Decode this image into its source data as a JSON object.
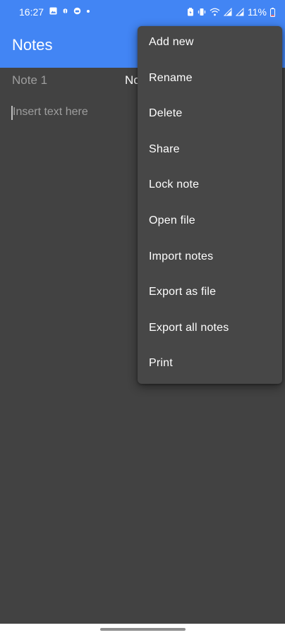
{
  "status_bar": {
    "time": "16:27",
    "battery": "11%",
    "left_icons": [
      "image-icon",
      "bug-icon",
      "robot-icon",
      "dot-icon"
    ],
    "right_icons": [
      "battery-saver-icon",
      "vibrate-icon",
      "wifi-icon",
      "signal-icon",
      "signal-icon",
      "battery-icon"
    ]
  },
  "app_bar": {
    "title": "Notes"
  },
  "tabs": [
    {
      "label": "Note 1",
      "selected": false
    },
    {
      "label": "No",
      "selected": true
    }
  ],
  "editor": {
    "placeholder": "Insert text here"
  },
  "menu": {
    "items": [
      {
        "label": "Add new"
      },
      {
        "label": "Rename"
      },
      {
        "label": "Delete"
      },
      {
        "label": "Share"
      },
      {
        "label": "Lock note"
      },
      {
        "label": "Open file"
      },
      {
        "label": "Import notes"
      },
      {
        "label": "Export as file"
      },
      {
        "label": "Export all notes"
      },
      {
        "label": "Print"
      }
    ]
  },
  "colors": {
    "primary": "#4285f4",
    "background": "#424242",
    "menu_background": "#474747"
  }
}
